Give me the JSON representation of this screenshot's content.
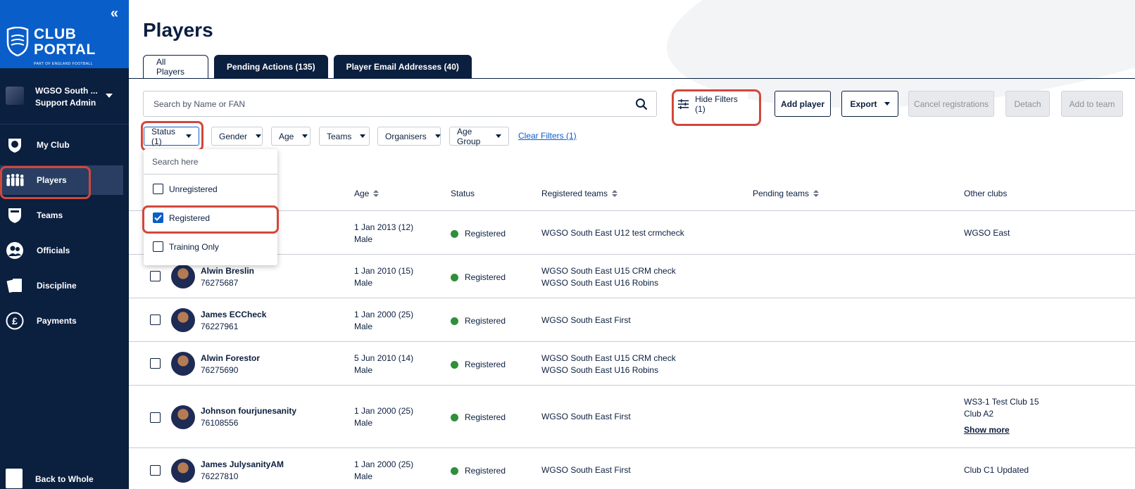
{
  "sidebar": {
    "collapse_label": "«",
    "brand": {
      "line1": "CLUB",
      "line2": "PORTAL",
      "tagline": "PART OF ENGLAND FOOTBALL"
    },
    "account": {
      "name": "WGSO South ...",
      "role": "Support Admin"
    },
    "nav": [
      {
        "label": "My Club",
        "icon": "shield-icon"
      },
      {
        "label": "Players",
        "icon": "players-icon",
        "active": true
      },
      {
        "label": "Teams",
        "icon": "team-shield-icon"
      },
      {
        "label": "Officials",
        "icon": "officials-icon"
      },
      {
        "label": "Discipline",
        "icon": "cards-icon"
      },
      {
        "label": "Payments",
        "icon": "pound-icon"
      }
    ],
    "back_label": "Back to Whole"
  },
  "page": {
    "title": "Players",
    "tabs": [
      "All Players",
      "Pending Actions (135)",
      "Player Email Addresses (40)"
    ]
  },
  "toolbar": {
    "search_placeholder": "Search by Name or FAN",
    "hide_filters": "Hide Filters (1)",
    "add_player": "Add player",
    "export": "Export",
    "cancel_registrations": "Cancel registrations",
    "detach": "Detach",
    "add_to_team": "Add to team"
  },
  "filters": {
    "chips": [
      "Status (1)",
      "Gender",
      "Age",
      "Teams",
      "Organisers",
      "Age Group"
    ],
    "clear": "Clear Filters (1)"
  },
  "status_dropdown": {
    "search_placeholder": "Search here",
    "options": [
      {
        "label": "Unregistered",
        "checked": false
      },
      {
        "label": "Registered",
        "checked": true
      },
      {
        "label": "Training Only",
        "checked": false
      }
    ]
  },
  "table": {
    "headers": {
      "age": "Age",
      "status": "Status",
      "registered_teams": "Registered teams",
      "pending_teams": "Pending teams",
      "other_clubs": "Other clubs"
    },
    "rows": [
      {
        "name": "",
        "fan": "",
        "dob": "1 Jan 2013 (12)",
        "gender": "Male",
        "status": "Registered",
        "teams": [
          "WGSO South East U12 test crmcheck"
        ],
        "other_clubs": [
          "WGSO East"
        ],
        "show_more": ""
      },
      {
        "name": "Alwin Breslin",
        "fan": "76275687",
        "dob": "1 Jan 2010 (15)",
        "gender": "Male",
        "status": "Registered",
        "teams": [
          "WGSO South East U15 CRM check",
          "WGSO South East U16 Robins"
        ],
        "other_clubs": [],
        "show_more": ""
      },
      {
        "name": "James ECCheck",
        "fan": "76227961",
        "dob": "1 Jan 2000 (25)",
        "gender": "Male",
        "status": "Registered",
        "teams": [
          "WGSO South East First"
        ],
        "other_clubs": [],
        "show_more": ""
      },
      {
        "name": "Alwin Forestor",
        "fan": "76275690",
        "dob": "5 Jun 2010 (14)",
        "gender": "Male",
        "status": "Registered",
        "teams": [
          "WGSO South East U15 CRM check",
          "WGSO South East U16 Robins"
        ],
        "other_clubs": [],
        "show_more": ""
      },
      {
        "name": "Johnson fourjunesanity",
        "fan": "76108556",
        "dob": "1 Jan 2000 (25)",
        "gender": "Male",
        "status": "Registered",
        "teams": [
          "WGSO South East First"
        ],
        "other_clubs": [
          "WS3-1 Test Club 15",
          "Club A2"
        ],
        "show_more": "Show more"
      },
      {
        "name": "James JulysanityAM",
        "fan": "76227810",
        "dob": "1 Jan 2000 (25)",
        "gender": "Male",
        "status": "Registered",
        "teams": [
          "WGSO South East First"
        ],
        "other_clubs": [
          "Club C1 Updated"
        ],
        "show_more": ""
      }
    ]
  },
  "colors": {
    "sidebar_bg": "#0b1f3f",
    "brand_blue": "#0a5ec9",
    "highlight_red": "#d2473b",
    "registered_green": "#2f8f3a"
  }
}
